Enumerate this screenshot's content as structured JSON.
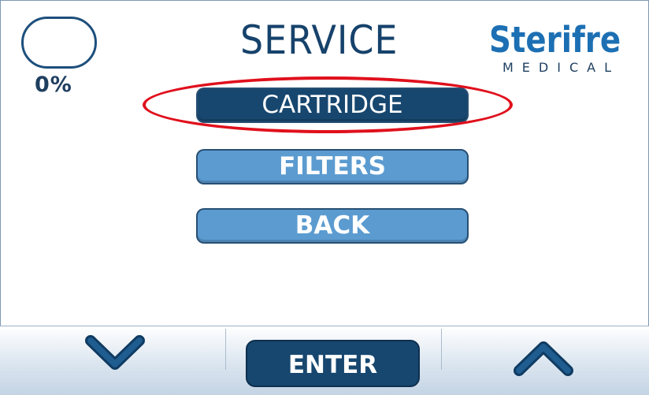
{
  "header": {
    "title": "SERVICE",
    "logo_main": "Sterifre",
    "logo_sub": "MEDICAL"
  },
  "status": {
    "cartridge_level_text": "0%",
    "cartridge_level_fraction": 0
  },
  "menu": {
    "items": [
      {
        "label": "CARTRIDGE",
        "selected": true
      },
      {
        "label": "FILTERS",
        "selected": false
      },
      {
        "label": "BACK",
        "selected": false
      }
    ]
  },
  "footer": {
    "down_icon": "chevron-down-icon",
    "enter_label": "ENTER",
    "up_icon": "chevron-up-icon"
  },
  "colors": {
    "primary_dark": "#17476f",
    "button_light": "#5b9bd0",
    "brand_blue": "#1c6fb3",
    "highlight_red": "#e0101c"
  }
}
